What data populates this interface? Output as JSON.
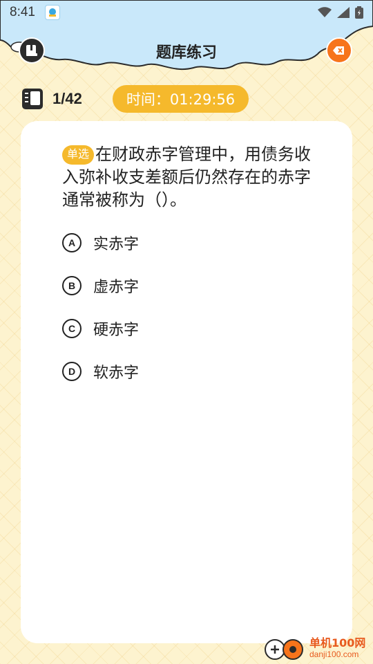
{
  "status_bar": {
    "time": "8:41",
    "icons": [
      "wifi-icon",
      "signal-icon",
      "battery-icon"
    ]
  },
  "header": {
    "title": "题库练习",
    "left_icon": "book-icon",
    "right_icon": "exit-icon"
  },
  "progress": {
    "current": "1/42",
    "timer": "时间：01:29:56"
  },
  "question": {
    "type_tag": "单选",
    "text": "在财政赤字管理中，用债务收入弥补收支差额后仍然存在的赤字通常被称为（）。",
    "options": [
      {
        "letter": "A",
        "text": "实赤字"
      },
      {
        "letter": "B",
        "text": "虚赤字"
      },
      {
        "letter": "C",
        "text": "硬赤字"
      },
      {
        "letter": "D",
        "text": "软赤字"
      }
    ]
  },
  "watermark": {
    "name": "单机100网",
    "url": "danji100.com"
  },
  "colors": {
    "sky": "#c9e8fa",
    "background": "#fdf3cf",
    "accent_yellow": "#f5b92c",
    "accent_orange": "#f7741b"
  }
}
